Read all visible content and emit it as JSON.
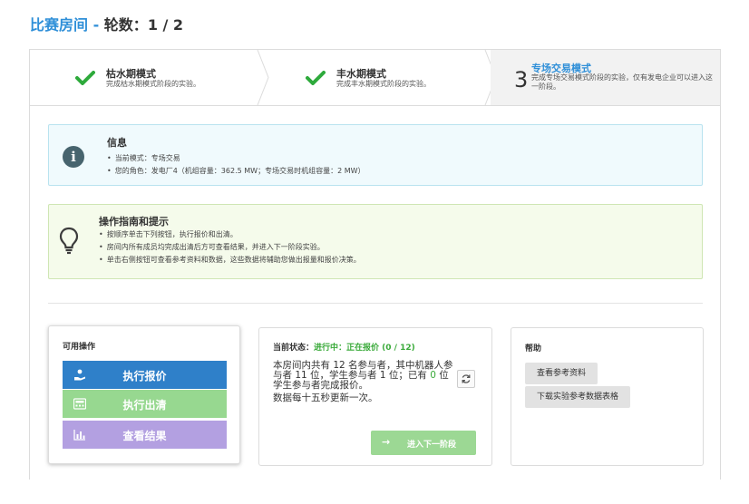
{
  "header": {
    "room": "比赛房间",
    "sep": " - ",
    "round_label": "轮数：",
    "round_value": "1 / 2"
  },
  "steps": [
    {
      "title": "枯水期模式",
      "desc": "完成枯水期模式阶段的实验。",
      "state": "done"
    },
    {
      "title": "丰水期模式",
      "desc": "完成丰水期模式阶段的实验。",
      "state": "done"
    },
    {
      "number": "3",
      "title": "专场交易模式",
      "desc": "完成专场交易模式阶段的实验，仅有发电企业可以进入这一阶段。",
      "state": "active"
    }
  ],
  "info": {
    "title": "信息",
    "lines": [
      "当前模式：专场交易",
      "您的角色：发电厂4（机组容量：362.5 MW；专场交易时机组容量：2 MW）"
    ]
  },
  "guide": {
    "title": "操作指南和提示",
    "lines": [
      "按顺序单击下列按钮，执行报价和出清。",
      "房间内所有成员均完成出清后方可查看结果，并进入下一阶段实验。",
      "单击右侧按钮可查看参考资料和数据，这些数据将辅助您做出报量和报价决策。"
    ]
  },
  "operations": {
    "title": "可用操作",
    "bid": "执行报价",
    "clear": "执行出清",
    "result": "查看结果"
  },
  "status": {
    "label": "当前状态：",
    "value": "进行中：正在报价 (0 / 12)",
    "text_1": "本房间内共有 12 名参与者，其中机器人参与者 11 位，学生参与者 1 位；已有",
    "done_count": "0",
    "text_2": "位学生参与者完成报价。",
    "refresh_note": "数据每十五秒更新一次。",
    "next_button": "进入下一阶段"
  },
  "help": {
    "title": "帮助",
    "ref_button": "查看参考资料",
    "download_button": "下载实验参考数据表格"
  },
  "colors": {
    "accent_blue": "#2f80c9",
    "success_green": "#3aaa3a",
    "clear_green": "#97d890",
    "result_purple": "#b3a0e1"
  }
}
